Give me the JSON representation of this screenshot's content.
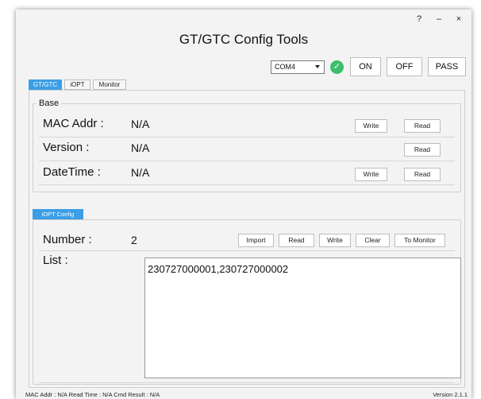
{
  "window": {
    "help": "?",
    "minimize": "–",
    "close": "×"
  },
  "app_title": "GT/GTC Config Tools",
  "toolbar": {
    "com_port": "COM4",
    "status_icon": "check-icon",
    "on": "ON",
    "off": "OFF",
    "pass": "PASS"
  },
  "tabs": [
    "GT/GTC",
    "iOPT",
    "Monitor"
  ],
  "base": {
    "legend": "Base",
    "rows": [
      {
        "label": "MAC Addr :",
        "value": "N/A"
      },
      {
        "label": "Version :",
        "value": "N/A"
      },
      {
        "label": "DateTime :",
        "value": "N/A"
      }
    ],
    "write": "Write",
    "read": "Read"
  },
  "iopt_config": {
    "tab": "iOPT Config",
    "number_label": "Number :",
    "number_value": "2",
    "buttons": {
      "import": "Import",
      "read": "Read",
      "write": "Write",
      "clear": "Clear",
      "to_monitor": "To Monitor"
    },
    "list_label": "List :",
    "list_value": "230727000001,230727000002"
  },
  "status_bar": {
    "left": "MAC Addr : N/A   Read Time : N/A   Cmd Result : N/A",
    "version": "Version  2.1.1"
  },
  "colors": {
    "accent": "#3b9ee6",
    "ok": "#3cbf6a"
  }
}
